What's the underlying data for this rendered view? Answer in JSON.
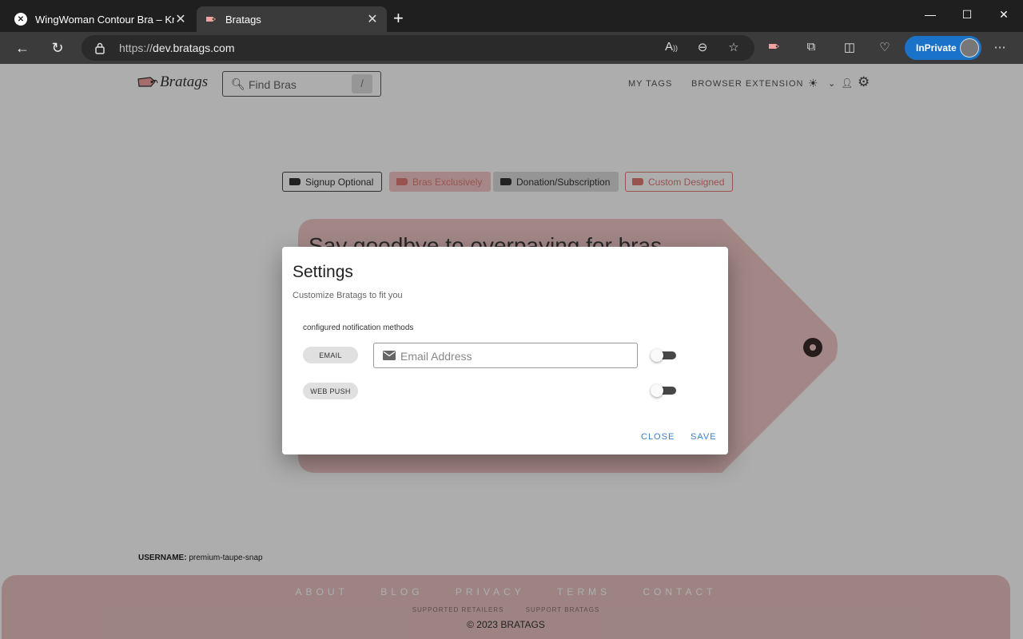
{
  "browser": {
    "tabs": [
      {
        "title": "WingWoman Contour Bra – Knix",
        "favicon": "knix-icon",
        "active": false
      },
      {
        "title": "Bratags",
        "favicon": "bratags-icon",
        "active": true
      }
    ],
    "url_scheme": "https://",
    "url_host": "dev.bratags.com",
    "inprivate_label": "InPrivate"
  },
  "site": {
    "logo_text": "Bratags",
    "search_placeholder": "Find Bras",
    "search_shortcut": "/",
    "nav": {
      "my_tags": "MY TAGS",
      "browser_extension": "BROWSER EXTENSION"
    },
    "chips": [
      {
        "label": "Signup Optional",
        "style": "outline-dark"
      },
      {
        "label": "Bras Exclusively",
        "style": "filled-pink"
      },
      {
        "label": "Donation/Subscription",
        "style": "filled-dark"
      },
      {
        "label": "Custom Designed",
        "style": "outline-pink"
      }
    ],
    "hero_text": "Say goodbye to overpaying for bras",
    "username_label": "USERNAME:",
    "username_value": "premium-taupe-snap",
    "footer": {
      "links": [
        "ABOUT",
        "BLOG",
        "PRIVACY",
        "TERMS",
        "CONTACT"
      ],
      "sublinks": [
        "SUPPORTED RETAILERS",
        "SUPPORT BRATAGS"
      ],
      "copyright": "© 2023 BRATAGS"
    }
  },
  "dialog": {
    "title": "Settings",
    "subtitle": "Customize Bratags to fit you",
    "section_label": "configured notification methods",
    "methods": [
      {
        "label": "EMAIL",
        "enabled": false
      },
      {
        "label": "WEB PUSH",
        "enabled": false
      }
    ],
    "email_placeholder": "Email Address",
    "close_label": "CLOSE",
    "save_label": "SAVE"
  },
  "colors": {
    "accent_pink": "#e07b78",
    "tag_pink": "#f0c8c7",
    "link_blue": "#3b82c8",
    "inprivate_blue": "#1a73c8"
  }
}
